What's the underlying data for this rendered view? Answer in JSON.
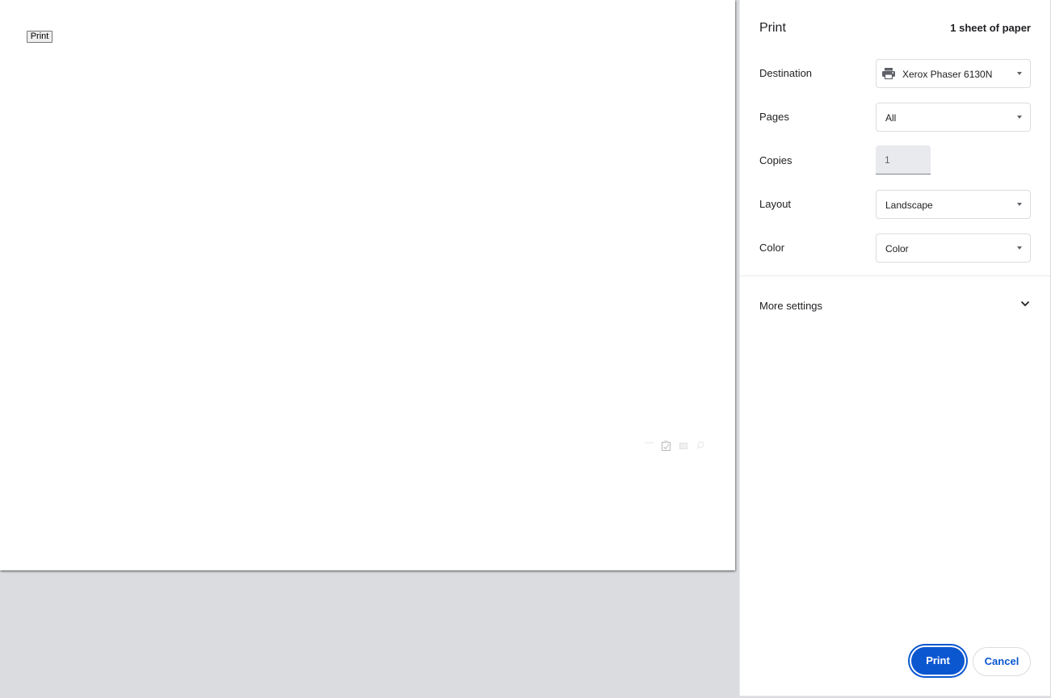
{
  "preview": {
    "page_button_label": "Print"
  },
  "panel": {
    "title": "Print",
    "sheet_count": "1 sheet of paper",
    "destination": {
      "label": "Destination",
      "value": "Xerox Phaser 6130N",
      "icon": "printer-icon"
    },
    "pages": {
      "label": "Pages",
      "value": "All"
    },
    "copies": {
      "label": "Copies",
      "value": "1"
    },
    "layout": {
      "label": "Layout",
      "value": "Landscape"
    },
    "color": {
      "label": "Color",
      "value": "Color"
    },
    "more_settings": {
      "label": "More settings",
      "icon": "chevron-down-icon"
    },
    "print_label": "Print",
    "cancel_label": "Cancel"
  },
  "colors": {
    "accent": "#0b57d0",
    "preview_background": "#dadce0"
  }
}
